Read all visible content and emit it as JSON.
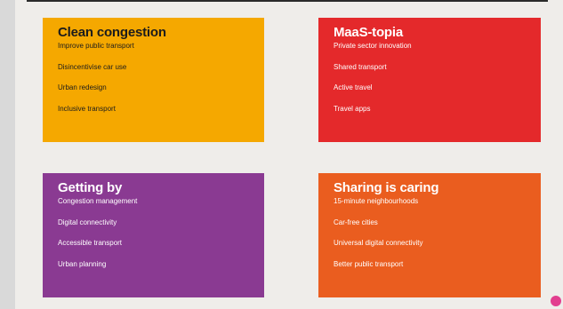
{
  "cards": [
    {
      "title": "Clean congestion",
      "items": [
        "Improve public transport",
        "Disincentivise car use",
        "Urban redesign",
        "Inclusive transport"
      ],
      "color": "#f5a800"
    },
    {
      "title": "MaaS-topia",
      "items": [
        "Private sector innovation",
        "Shared transport",
        "Active travel",
        "Travel apps"
      ],
      "color": "#e4292b"
    },
    {
      "title": "Getting by",
      "items": [
        "Congestion management",
        "Digital connectivity",
        "Accessible transport",
        "Urban planning"
      ],
      "color": "#8a3a92"
    },
    {
      "title": "Sharing is caring",
      "items": [
        "15-minute neighbourhoods",
        "Car-free cities",
        "Universal digital connectivity",
        "Better public transport"
      ],
      "color": "#ea5d1f"
    }
  ],
  "corner_icon": "pink-dot-icon"
}
